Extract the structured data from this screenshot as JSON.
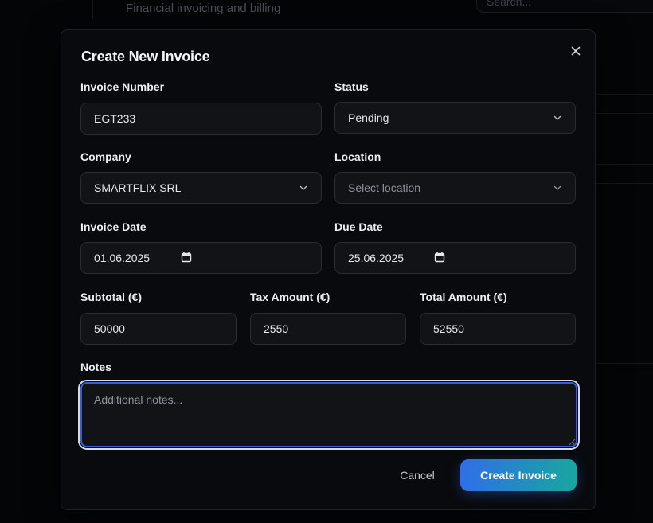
{
  "background": {
    "subtitle": "Financial invoicing and billing",
    "search_placeholder": "Search..."
  },
  "modal": {
    "title": "Create New Invoice",
    "close_icon": "close-icon",
    "fields": {
      "invoice_number": {
        "label": "Invoice Number",
        "value": "EGT233"
      },
      "status": {
        "label": "Status",
        "value": "Pending"
      },
      "company": {
        "label": "Company",
        "value": "SMARTFLIX SRL"
      },
      "location": {
        "label": "Location",
        "placeholder": "Select location"
      },
      "invoice_date": {
        "label": "Invoice Date",
        "value": "01.06.2025"
      },
      "due_date": {
        "label": "Due Date",
        "value": "25.06.2025"
      },
      "subtotal": {
        "label": "Subtotal (€)",
        "value": "50000"
      },
      "tax_amount": {
        "label": "Tax Amount (€)",
        "value": "2550"
      },
      "total_amount": {
        "label": "Total Amount (€)",
        "value": "52550"
      },
      "notes": {
        "label": "Notes",
        "placeholder": "Additional notes..."
      }
    },
    "buttons": {
      "cancel": "Cancel",
      "create": "Create Invoice"
    }
  },
  "colors": {
    "accent_gradient_start": "#2f6ee8",
    "accent_gradient_end": "#18a7a0",
    "focus_border": "#3b5bdb",
    "field_background": "#121316",
    "modal_background": "#090a0d"
  }
}
